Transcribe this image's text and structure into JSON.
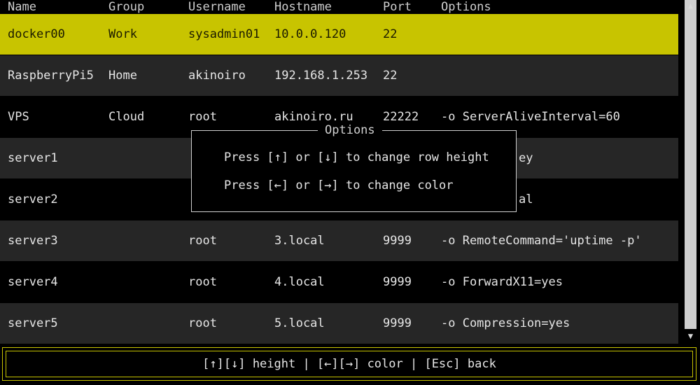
{
  "header": {
    "name": "Name",
    "group": "Group",
    "username": "Username",
    "hostname": "Hostname",
    "port": "Port",
    "options": "Options"
  },
  "rows": [
    {
      "name": "docker00",
      "group": "Work",
      "username": "sysadmin01",
      "hostname": "10.0.0.120",
      "port": "22",
      "options": ""
    },
    {
      "name": "RaspberryPi5",
      "group": "Home",
      "username": "akinoiro",
      "hostname": "192.168.1.253",
      "port": "22",
      "options": ""
    },
    {
      "name": "VPS",
      "group": "Cloud",
      "username": "root",
      "hostname": "akinoiro.ru",
      "port": "22222",
      "options": "-o ServerAliveInterval=60"
    },
    {
      "name": "server1",
      "group": "",
      "username": "",
      "hostname": "",
      "port": "",
      "options": "ey"
    },
    {
      "name": "server2",
      "group": "",
      "username": "",
      "hostname": "",
      "port": "",
      "options": "al"
    },
    {
      "name": "server3",
      "group": "",
      "username": "root",
      "hostname": "3.local",
      "port": "9999",
      "options": "-o RemoteCommand='uptime -p'"
    },
    {
      "name": "server4",
      "group": "",
      "username": "root",
      "hostname": "4.local",
      "port": "9999",
      "options": "-o ForwardX11=yes"
    },
    {
      "name": "server5",
      "group": "",
      "username": "root",
      "hostname": "5.local",
      "port": "9999",
      "options": "-o Compression=yes"
    }
  ],
  "selected_row": 0,
  "modal": {
    "title": "Options",
    "line1": "Press [↑] or [↓] to change row height",
    "line2": "Press [←] or [→] to change color"
  },
  "footer": {
    "hint": "[↑][↓] height | [←][→] color | [Esc] back"
  },
  "scrollbar": {
    "up_arrow": "▲",
    "down_arrow": "▼"
  },
  "colors": {
    "selected_bg": "#c8c400",
    "odd_row_bg": "#262626",
    "even_row_bg": "#000000"
  }
}
